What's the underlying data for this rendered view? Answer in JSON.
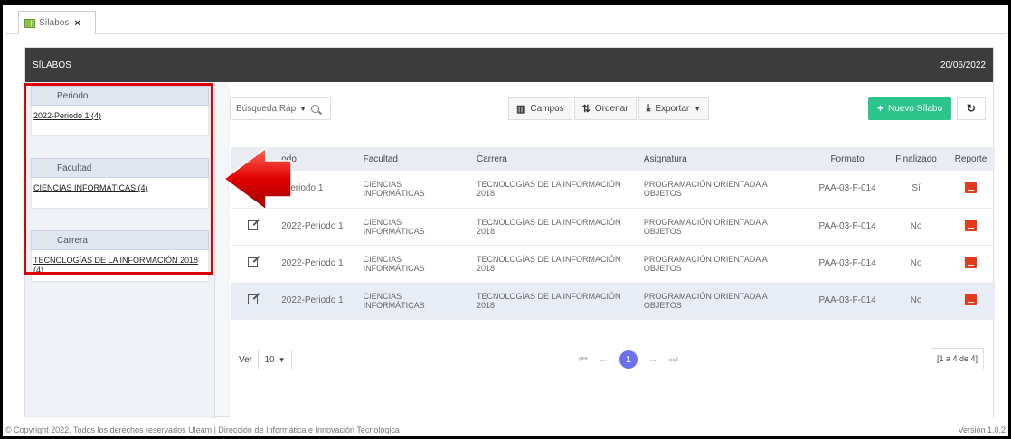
{
  "tab": {
    "label": "Sílabos",
    "close": "×"
  },
  "header": {
    "title": "SÍLABOS",
    "date": "20/06/2022"
  },
  "sidebar": {
    "facets": [
      {
        "title": "Periodo",
        "value": "2022-Periodo 1 (4)"
      },
      {
        "title": "Facultad",
        "value": "CIENCIAS INFORMÁTICAS (4)"
      },
      {
        "title": "Carrera",
        "value": "TECNOLOGÍAS DE LA INFORMACIÓN 2018 (4)"
      }
    ]
  },
  "toolbar": {
    "search_placeholder": "Búsqueda Ráp",
    "campos": "Campos",
    "ordenar": "Ordenar",
    "exportar": "Exportar",
    "new_button": "Nuevo Sílabo"
  },
  "table": {
    "headers": [
      "",
      "odo",
      "Facultad",
      "Carrera",
      "Asignatura",
      "Formato",
      "Finalizado",
      "Reporte"
    ],
    "rows": [
      {
        "periodo": "-Periodo 1",
        "facultad": "CIENCIAS INFORMÁTICAS",
        "carrera": "TECNOLOGÍAS DE LA INFORMACIÓN 2018",
        "asignatura": "PROGRAMACIÓN ORIENTADA A OBJETOS",
        "formato": "PAA-03-F-014",
        "finalizado": "Sí"
      },
      {
        "periodo": "2022-Periodo 1",
        "facultad": "CIENCIAS INFORMÁTICAS",
        "carrera": "TECNOLOGÍAS DE LA INFORMACIÓN 2018",
        "asignatura": "PROGRAMACIÓN ORIENTADA A OBJETOS",
        "formato": "PAA-03-F-014",
        "finalizado": "No"
      },
      {
        "periodo": "2022-Periodo 1",
        "facultad": "CIENCIAS INFORMÁTICAS",
        "carrera": "TECNOLOGÍAS DE LA INFORMACIÓN 2018",
        "asignatura": "PROGRAMACIÓN ORIENTADA A OBJETOS",
        "formato": "PAA-03-F-014",
        "finalizado": "No"
      },
      {
        "periodo": "2022-Periodo 1",
        "facultad": "CIENCIAS INFORMÁTICAS",
        "carrera": "TECNOLOGÍAS DE LA INFORMACIÓN 2018",
        "asignatura": "PROGRAMACIÓN ORIENTADA A OBJETOS",
        "formato": "PAA-03-F-014",
        "finalizado": "No"
      }
    ]
  },
  "pagination": {
    "view_label": "Ver",
    "page_size": "10",
    "current_page": "1",
    "count": "[1 a 4 de 4]"
  },
  "footer": {
    "copyright": "© Copyright 2022. Todos los derechos reservados Uleam | Dirección de Informática e Innovación Tecnológica",
    "version": "Versión 1.0.2"
  },
  "colors": {
    "header_bg": "#3c3c3c",
    "accent_green": "#2bc48a",
    "annotation_red": "#e00000",
    "pager_active": "#6b6ff0",
    "pdf_red": "#e53a1e"
  }
}
